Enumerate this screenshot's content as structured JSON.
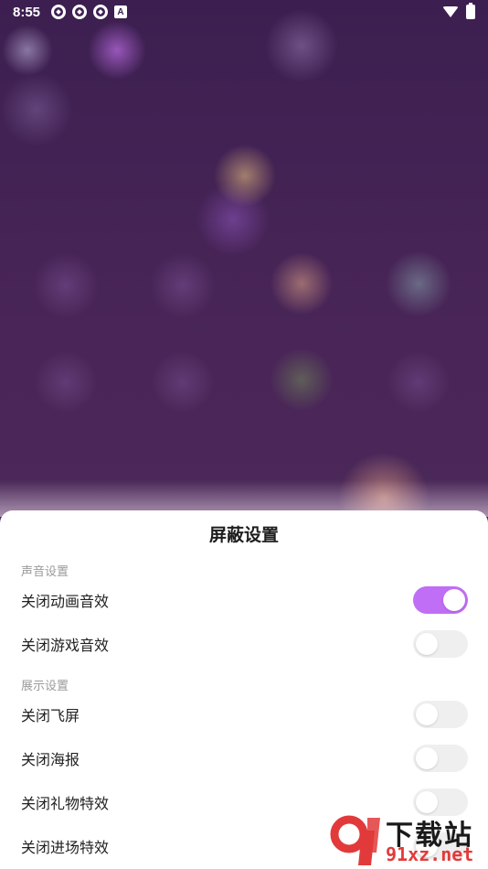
{
  "status_bar": {
    "time": "8:55",
    "notification_badge": "A",
    "icons": [
      "app-notification-icon",
      "app-notification-icon",
      "app-notification-icon",
      "a-badge-icon",
      "wifi-icon",
      "battery-charging-icon"
    ]
  },
  "sheet": {
    "title": "屏蔽设置",
    "sections": [
      {
        "label": "声音设置",
        "items": [
          {
            "label": "关闭动画音效",
            "on": true
          },
          {
            "label": "关闭游戏音效",
            "on": false
          }
        ]
      },
      {
        "label": "展示设置",
        "items": [
          {
            "label": "关闭飞屏",
            "on": false
          },
          {
            "label": "关闭海报",
            "on": false
          },
          {
            "label": "关闭礼物特效",
            "on": false
          },
          {
            "label": "关闭进场特效",
            "on": false
          }
        ]
      }
    ]
  },
  "watermark": {
    "top": "下载站",
    "bottom": "91xz.net"
  },
  "colors": {
    "accent": "#c06ef5",
    "toggle_off": "#efefef",
    "background": "#3f2150"
  }
}
